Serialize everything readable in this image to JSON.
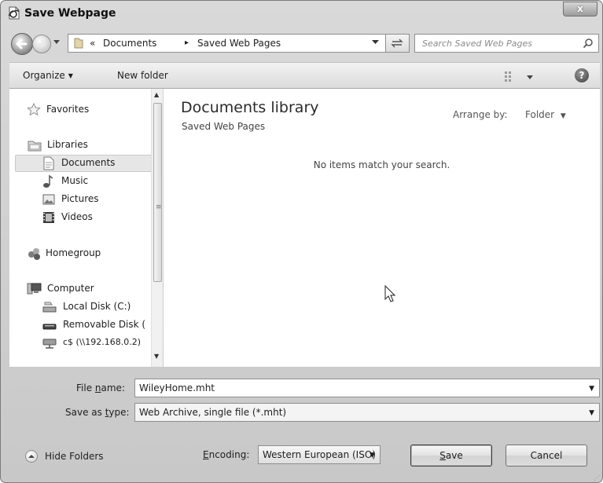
{
  "window": {
    "title": "Save Webpage",
    "close_glyph": "x"
  },
  "address": {
    "prefix": "«",
    "crumbs": [
      "Documents",
      "Saved Web Pages"
    ],
    "separator": "▸",
    "search_placeholder": "Search Saved Web Pages"
  },
  "toolbar": {
    "organize": "Organize",
    "new_folder": "New folder",
    "help": "?"
  },
  "nav": {
    "favorites": "Favorites",
    "libraries": "Libraries",
    "documents": "Documents",
    "music": "Music",
    "pictures": "Pictures",
    "videos": "Videos",
    "homegroup": "Homegroup",
    "computer": "Computer",
    "local_disk": "Local Disk (C:)",
    "removable_disk": "Removable Disk (",
    "network_share": "c$ (\\\\192.168.0.2)",
    "selected": "Documents"
  },
  "content": {
    "library_title": "Documents library",
    "library_subtitle": "Saved Web Pages",
    "arrange_label": "Arrange by:",
    "arrange_value": "Folder",
    "empty_message": "No items match your search."
  },
  "fields": {
    "file_name_label_pre": "File ",
    "file_name_label_u": "n",
    "file_name_label_post": "ame:",
    "file_name_value": "WileyHome.mht",
    "save_type_label_pre": "Save as ",
    "save_type_label_u": "t",
    "save_type_label_post": "ype:",
    "save_type_value": "Web Archive, single file (*.mht)",
    "encoding_label_pre": "",
    "encoding_label_u": "E",
    "encoding_label_post": "ncoding:",
    "encoding_value": "Western European (ISO)"
  },
  "buttons": {
    "hide_folders": "Hide Folders",
    "save_u": "S",
    "save_rest": "ave",
    "cancel": "Cancel"
  },
  "icons": {
    "app": "ie-page-icon",
    "back": "back-arrow-icon",
    "forward": "forward-arrow-icon",
    "refresh": "refresh-icon",
    "search": "search-icon",
    "views": "views-icon",
    "help": "help-icon",
    "favorites": "star-icon",
    "libraries": "library-icon",
    "documents": "document-icon",
    "music": "music-note-icon",
    "pictures": "picture-icon",
    "videos": "film-icon",
    "homegroup": "homegroup-icon",
    "computer": "computer-icon",
    "local_disk": "hard-disk-icon",
    "removable_disk": "removable-disk-icon",
    "network_share": "network-drive-icon",
    "cursor": "mouse-pointer-icon"
  }
}
